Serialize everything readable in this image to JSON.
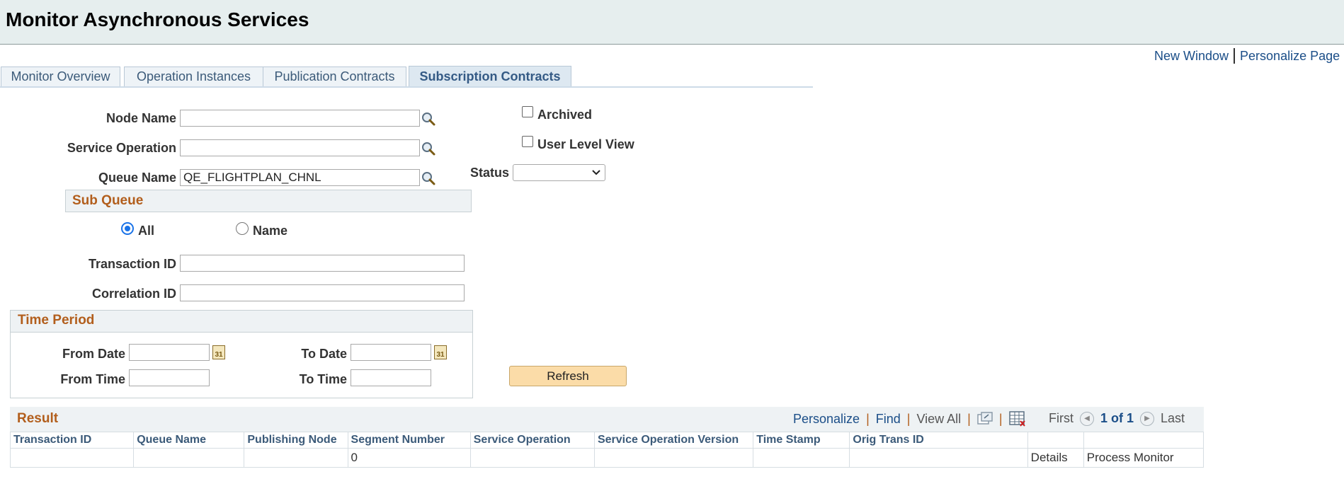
{
  "page": {
    "title": "Monitor Asynchronous Services"
  },
  "top_links": {
    "new_window": "New Window",
    "personalize_page": "Personalize Page"
  },
  "tabs": [
    {
      "label": "Monitor Overview",
      "active": false
    },
    {
      "label": "Operation Instances",
      "active": false
    },
    {
      "label": "Publication Contracts",
      "active": false
    },
    {
      "label": "Subscription Contracts",
      "active": true
    }
  ],
  "filters": {
    "node_name": {
      "label": "Node Name",
      "value": ""
    },
    "service_operation": {
      "label": "Service Operation",
      "value": ""
    },
    "queue_name": {
      "label": "Queue Name",
      "value": "QE_FLIGHTPLAN_CHNL"
    },
    "archived": {
      "label": "Archived",
      "checked": false
    },
    "user_level_view": {
      "label": "User Level View",
      "checked": false
    },
    "status": {
      "label": "Status",
      "value": ""
    },
    "sub_queue": {
      "title": "Sub Queue",
      "all_label": "All",
      "name_label": "Name",
      "selected": "All"
    },
    "transaction_id": {
      "label": "Transaction ID",
      "value": ""
    },
    "correlation_id": {
      "label": "Correlation ID",
      "value": ""
    },
    "time_period": {
      "title": "Time Period",
      "from_date_label": "From Date",
      "to_date_label": "To Date",
      "from_time_label": "From Time",
      "to_time_label": "To Time",
      "from_date": "",
      "to_date": "",
      "from_time": "",
      "to_time": "",
      "calendar_glyph": "31"
    },
    "refresh_label": "Refresh"
  },
  "result": {
    "title": "Result",
    "toolbar": {
      "personalize": "Personalize",
      "find": "Find",
      "view_all": "View All",
      "first": "First",
      "page_count": "1 of 1",
      "last": "Last"
    },
    "columns": [
      "Transaction ID",
      "Queue Name",
      "Publishing Node",
      "Segment Number",
      "Service Operation",
      "Service Operation Version",
      "Time Stamp",
      "Orig Trans ID",
      "",
      ""
    ],
    "rows": [
      [
        "",
        "",
        "",
        "0",
        "",
        "",
        "",
        "",
        "Details",
        "Process Monitor"
      ]
    ]
  },
  "icons": {
    "lookup": "magnifier-icon",
    "calendar": "calendar-icon",
    "zoom": "zoom-grid-icon",
    "download": "download-excel-icon"
  },
  "colors": {
    "header_bg": "#e6eeee",
    "link": "#1b4e88",
    "section_title": "#b25e1c",
    "button_bg": "#fbdca8"
  }
}
